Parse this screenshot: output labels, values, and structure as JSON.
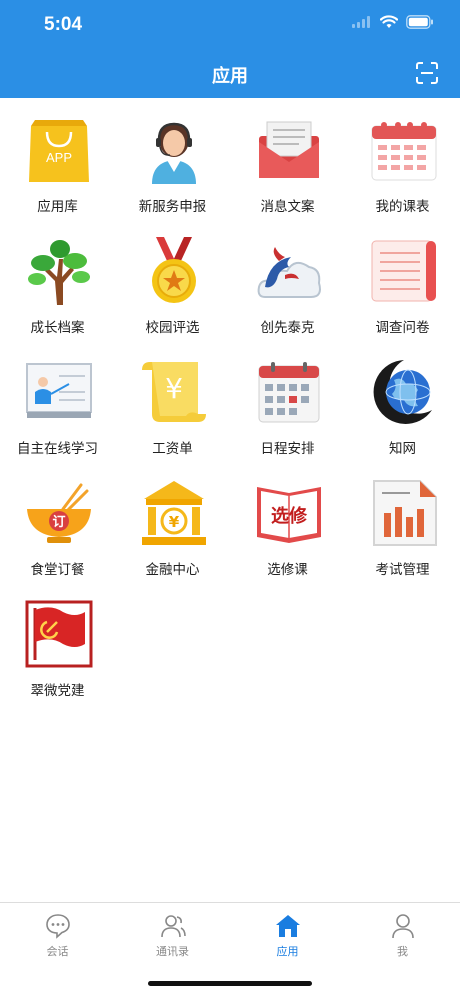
{
  "status": {
    "time": "5:04"
  },
  "header": {
    "title": "应用"
  },
  "apps": [
    {
      "label": "应用库",
      "icon": "app-store-bag-icon"
    },
    {
      "label": "新服务申报",
      "icon": "customer-service-agent-icon"
    },
    {
      "label": "消息文案",
      "icon": "envelope-icon"
    },
    {
      "label": "我的课表",
      "icon": "calendar-icon"
    },
    {
      "label": "成长档案",
      "icon": "tree-icon"
    },
    {
      "label": "校园评选",
      "icon": "medal-icon"
    },
    {
      "label": "创先泰克",
      "icon": "dolphin-cloud-icon"
    },
    {
      "label": "调查问卷",
      "icon": "scroll-document-icon"
    },
    {
      "label": "自主在线学习",
      "icon": "presentation-board-icon"
    },
    {
      "label": "工资单",
      "icon": "yen-scroll-icon"
    },
    {
      "label": "日程安排",
      "icon": "schedule-calendar-icon"
    },
    {
      "label": "知网",
      "icon": "globe-icon"
    },
    {
      "label": "食堂订餐",
      "icon": "bowl-chopsticks-icon"
    },
    {
      "label": "金融中心",
      "icon": "bank-icon"
    },
    {
      "label": "选修课",
      "icon": "open-book-icon"
    },
    {
      "label": "考试管理",
      "icon": "bar-chart-document-icon"
    },
    {
      "label": "翠微党建",
      "icon": "party-flag-icon"
    }
  ],
  "icon_text": {
    "app": "APP",
    "yen": "¥",
    "order": "订",
    "elective": "选修"
  },
  "tabs": [
    {
      "label": "会话",
      "icon": "chat-bubble-icon",
      "active": false
    },
    {
      "label": "通讯录",
      "icon": "contacts-icon",
      "active": false
    },
    {
      "label": "应用",
      "icon": "home-icon",
      "active": true
    },
    {
      "label": "我",
      "icon": "person-icon",
      "active": false
    }
  ],
  "colors": {
    "header": "#2b8fe5",
    "active_tab": "#1a7de0",
    "inactive_tab": "#888888"
  }
}
